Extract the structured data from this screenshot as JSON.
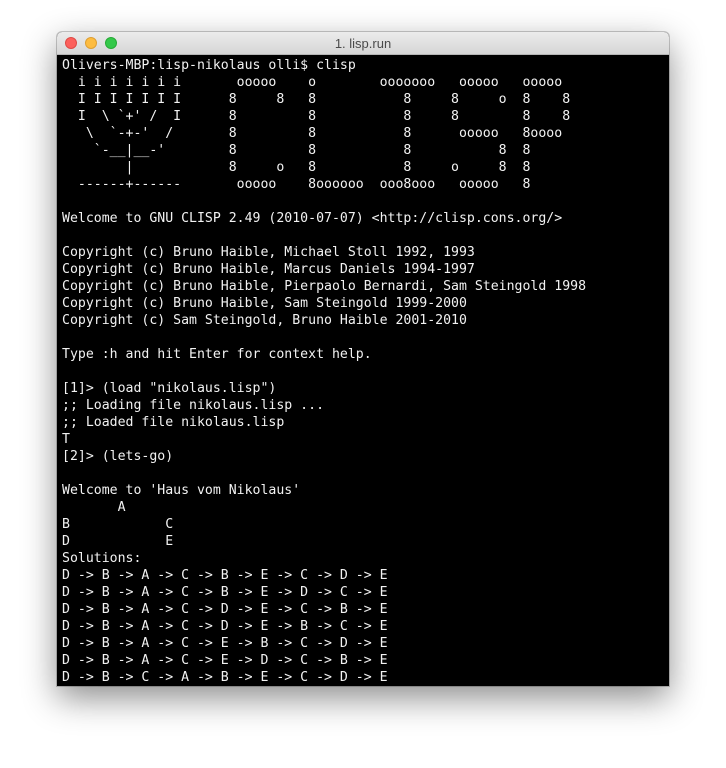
{
  "window": {
    "title": "1. lisp.run"
  },
  "terminal": {
    "lines": [
      "Olivers-MBP:lisp-nikolaus olli$ clisp",
      "  i i i i i i i       ooooo    o        ooooooo   ooooo   ooooo",
      "  I I I I I I I      8     8   8           8     8     o  8    8",
      "  I  \\ `+' /  I      8         8           8     8        8    8",
      "   \\  `-+-'  /       8         8           8      ooooo   8oooo",
      "    `-__|__-'        8         8           8           8  8",
      "        |            8     o   8           8     o     8  8",
      "  ------+------       ooooo    8oooooo  ooo8ooo   ooooo   8",
      "",
      "Welcome to GNU CLISP 2.49 (2010-07-07) <http://clisp.cons.org/>",
      "",
      "Copyright (c) Bruno Haible, Michael Stoll 1992, 1993",
      "Copyright (c) Bruno Haible, Marcus Daniels 1994-1997",
      "Copyright (c) Bruno Haible, Pierpaolo Bernardi, Sam Steingold 1998",
      "Copyright (c) Bruno Haible, Sam Steingold 1999-2000",
      "Copyright (c) Sam Steingold, Bruno Haible 2001-2010",
      "",
      "Type :h and hit Enter for context help.",
      "",
      "[1]> (load \"nikolaus.lisp\")",
      ";; Loading file nikolaus.lisp ...",
      ";; Loaded file nikolaus.lisp",
      "T",
      "[2]> (lets-go)",
      "",
      "Welcome to 'Haus vom Nikolaus'",
      "       A",
      "B            C",
      "D            E",
      "Solutions:",
      "D -> B -> A -> C -> B -> E -> C -> D -> E",
      "D -> B -> A -> C -> B -> E -> D -> C -> E",
      "D -> B -> A -> C -> D -> E -> C -> B -> E",
      "D -> B -> A -> C -> D -> E -> B -> C -> E",
      "D -> B -> A -> C -> E -> B -> C -> D -> E",
      "D -> B -> A -> C -> E -> D -> C -> B -> E",
      "D -> B -> C -> A -> B -> E -> C -> D -> E"
    ]
  }
}
